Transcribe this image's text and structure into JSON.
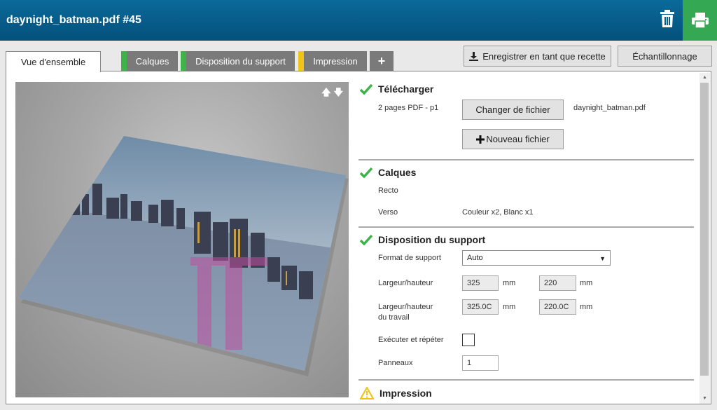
{
  "window": {
    "title": "daynight_batman.pdf #45"
  },
  "header": {
    "delete_icon": "trash-icon",
    "print_icon": "printer-icon",
    "print_color": "#35a853",
    "brand_color": "#0b6a9a"
  },
  "tabs": [
    {
      "label": "Vue d'ensemble",
      "active": true
    },
    {
      "label": "Calques",
      "status_color": "#3db34a"
    },
    {
      "label": "Disposition du support",
      "status_color": "#3db34a"
    },
    {
      "label": "Impression",
      "status_color": "#f0c419"
    },
    {
      "label": "+",
      "icon": "plus-icon"
    }
  ],
  "toolbar": {
    "save_recipe": "Enregistrer en tant que recette",
    "sampling": "Échantillonnage"
  },
  "preview": {
    "up_arrow": "🡅",
    "down_arrow": "🡇"
  },
  "sections": {
    "upload": {
      "title": "Télécharger",
      "pages": "2 pages PDF - p1",
      "change_file": "Changer de fichier",
      "filename": "daynight_batman.pdf",
      "new_file": "Nouveau fichier"
    },
    "layers": {
      "title": "Calques",
      "front_label": "Recto",
      "back_label": "Verso",
      "back_value": "Couleur x2, Blanc x1"
    },
    "media_layout": {
      "title": "Disposition du support",
      "format_label": "Format de support",
      "format_value": "Auto",
      "wh_label": "Largeur/hauteur",
      "width": "325",
      "height": "220",
      "unit": "mm",
      "work_wh_label_1": "Largeur/hauteur",
      "work_wh_label_2": "du travail",
      "work_width": "325.0C",
      "work_height": "220.0C",
      "step_repeat_label": "Exécuter et répéter",
      "panels_label": "Panneaux",
      "panels_value": "1"
    },
    "print": {
      "title": "Impression"
    }
  }
}
